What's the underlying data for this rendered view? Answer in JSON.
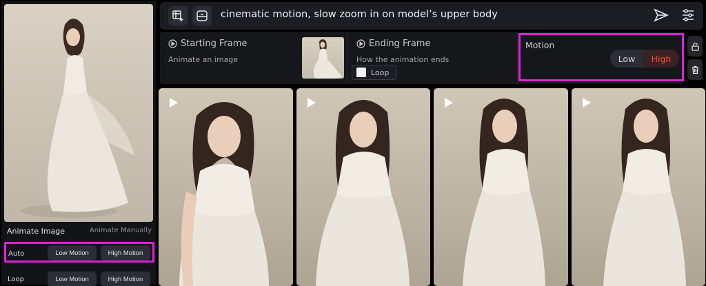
{
  "left_panel": {
    "animate_image_label": "Animate Image",
    "animate_manually_label": "Animate Manually",
    "rows": [
      {
        "label": "Auto",
        "low_label": "Low Motion",
        "high_label": "High Motion"
      },
      {
        "label": "Loop",
        "low_label": "Low Motion",
        "high_label": "High Motion"
      }
    ]
  },
  "prompt_bar": {
    "prompt": "cinematic motion, slow zoom in on model’s upper body",
    "icons": [
      "add-frame-icon",
      "image-frame-icon",
      "send-icon",
      "settings-sliders-icon"
    ]
  },
  "frames": {
    "starting_title": "Starting Frame",
    "starting_sub": "Animate an image",
    "ending_title": "Ending Frame",
    "ending_sub": "How the animation ends",
    "loop_label": "Loop"
  },
  "motion": {
    "title": "Motion",
    "low_label": "Low",
    "high_label": "High",
    "selected": "High"
  },
  "gallery": {
    "count": 4
  },
  "colors": {
    "accent_highlight": "#e020d8",
    "high_active": "#ff4a2a",
    "panel_bg": "#15171b"
  }
}
